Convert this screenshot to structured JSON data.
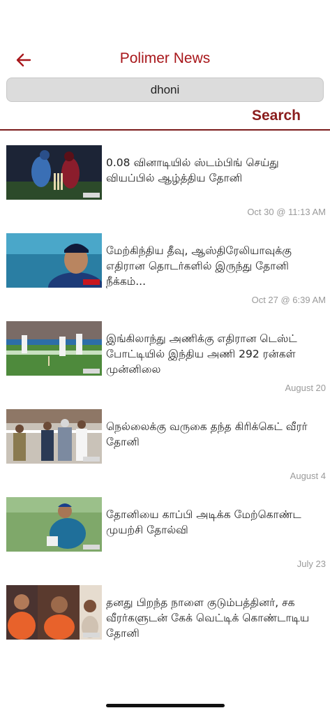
{
  "header": {
    "title": "Polimer News",
    "back_icon": "arrow-left-icon",
    "accent": "#a8171b"
  },
  "search": {
    "query": "dhoni",
    "button_label": "Search"
  },
  "articles": [
    {
      "headline": "0.08 வினாடியில் ஸ்டம்பிங் செய்து வியப்பில் ஆழ்த்திய தோனி",
      "date": "Oct 30 @ 11:13 AM"
    },
    {
      "headline": "மேற்கிந்திய தீவு, ஆஸ்திரேலியாவுக்கு எதிரான தொடர்களில் இருந்து தோனி நீக்கம்...",
      "date": "Oct 27 @ 6:39 AM"
    },
    {
      "headline": "இங்கிலாந்து அணிக்கு எதிரான டெஸ்ட் போட்டியில் இந்திய அணி 292 ரன்கள் முன்னிலை",
      "date": "August 20"
    },
    {
      "headline": "நெல்லைக்கு வருகை தந்த கிரிக்கெட் வீரர் தோனி",
      "date": "August 4"
    },
    {
      "headline": "தோனியை காப்பி அடிக்க மேற்கொண்ட முயற்சி தோல்வி",
      "date": "July 23"
    },
    {
      "headline": "தனது பிறந்த நாளை குடும்பத்தினர், சக வீரர்களுடன் கேக் வெட்டிக் கொண்டாடிய தோனி",
      "date": ""
    }
  ]
}
